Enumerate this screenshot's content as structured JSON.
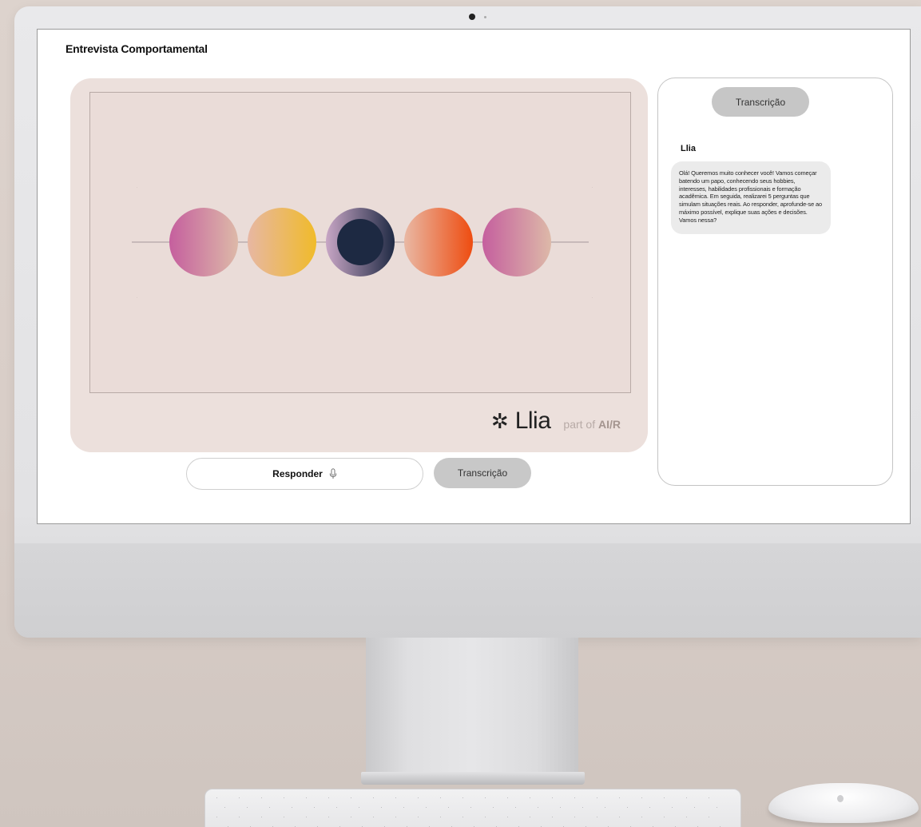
{
  "page": {
    "title": "Entrevista Comportamental"
  },
  "video": {
    "brand": {
      "icon": "asterisk-burst-icon",
      "name": "Llia",
      "tagline_prefix": "part of",
      "tagline_brand": "AI/R"
    },
    "orbs": [
      {
        "from": "#c55f9e",
        "to": "#ddb9a8"
      },
      {
        "from": "#e7b7a3",
        "to": "#f0bb2a"
      },
      {
        "from": "#c8a6c5",
        "to": "#1f2a44"
      },
      {
        "from": "#e9b8a4",
        "to": "#ee4c10"
      },
      {
        "from": "#c55f9e",
        "to": "#ddb9a8"
      }
    ]
  },
  "controls": {
    "respond_label": "Responder",
    "respond_icon": "microphone-icon",
    "transcription_label": "Transcrição"
  },
  "transcript": {
    "tab_label": "Transcrição",
    "speaker": "Llia",
    "message": "Olá! Queremos muito conhecer você! Vamos começar batendo um papo, conhecendo seus hobbies, interesses, habilidades profissionais e formação acadêmica. Em seguida, realizarei 5 perguntas que simulam situações reais. Ao responder, aprofunde-se ao máximo possível, explique suas ações e decisões. Vamos nessa?"
  },
  "colors": {
    "panel_bg": "#ece0dc",
    "button_gray": "#c8c8c8",
    "bubble_gray": "#ebebeb"
  }
}
